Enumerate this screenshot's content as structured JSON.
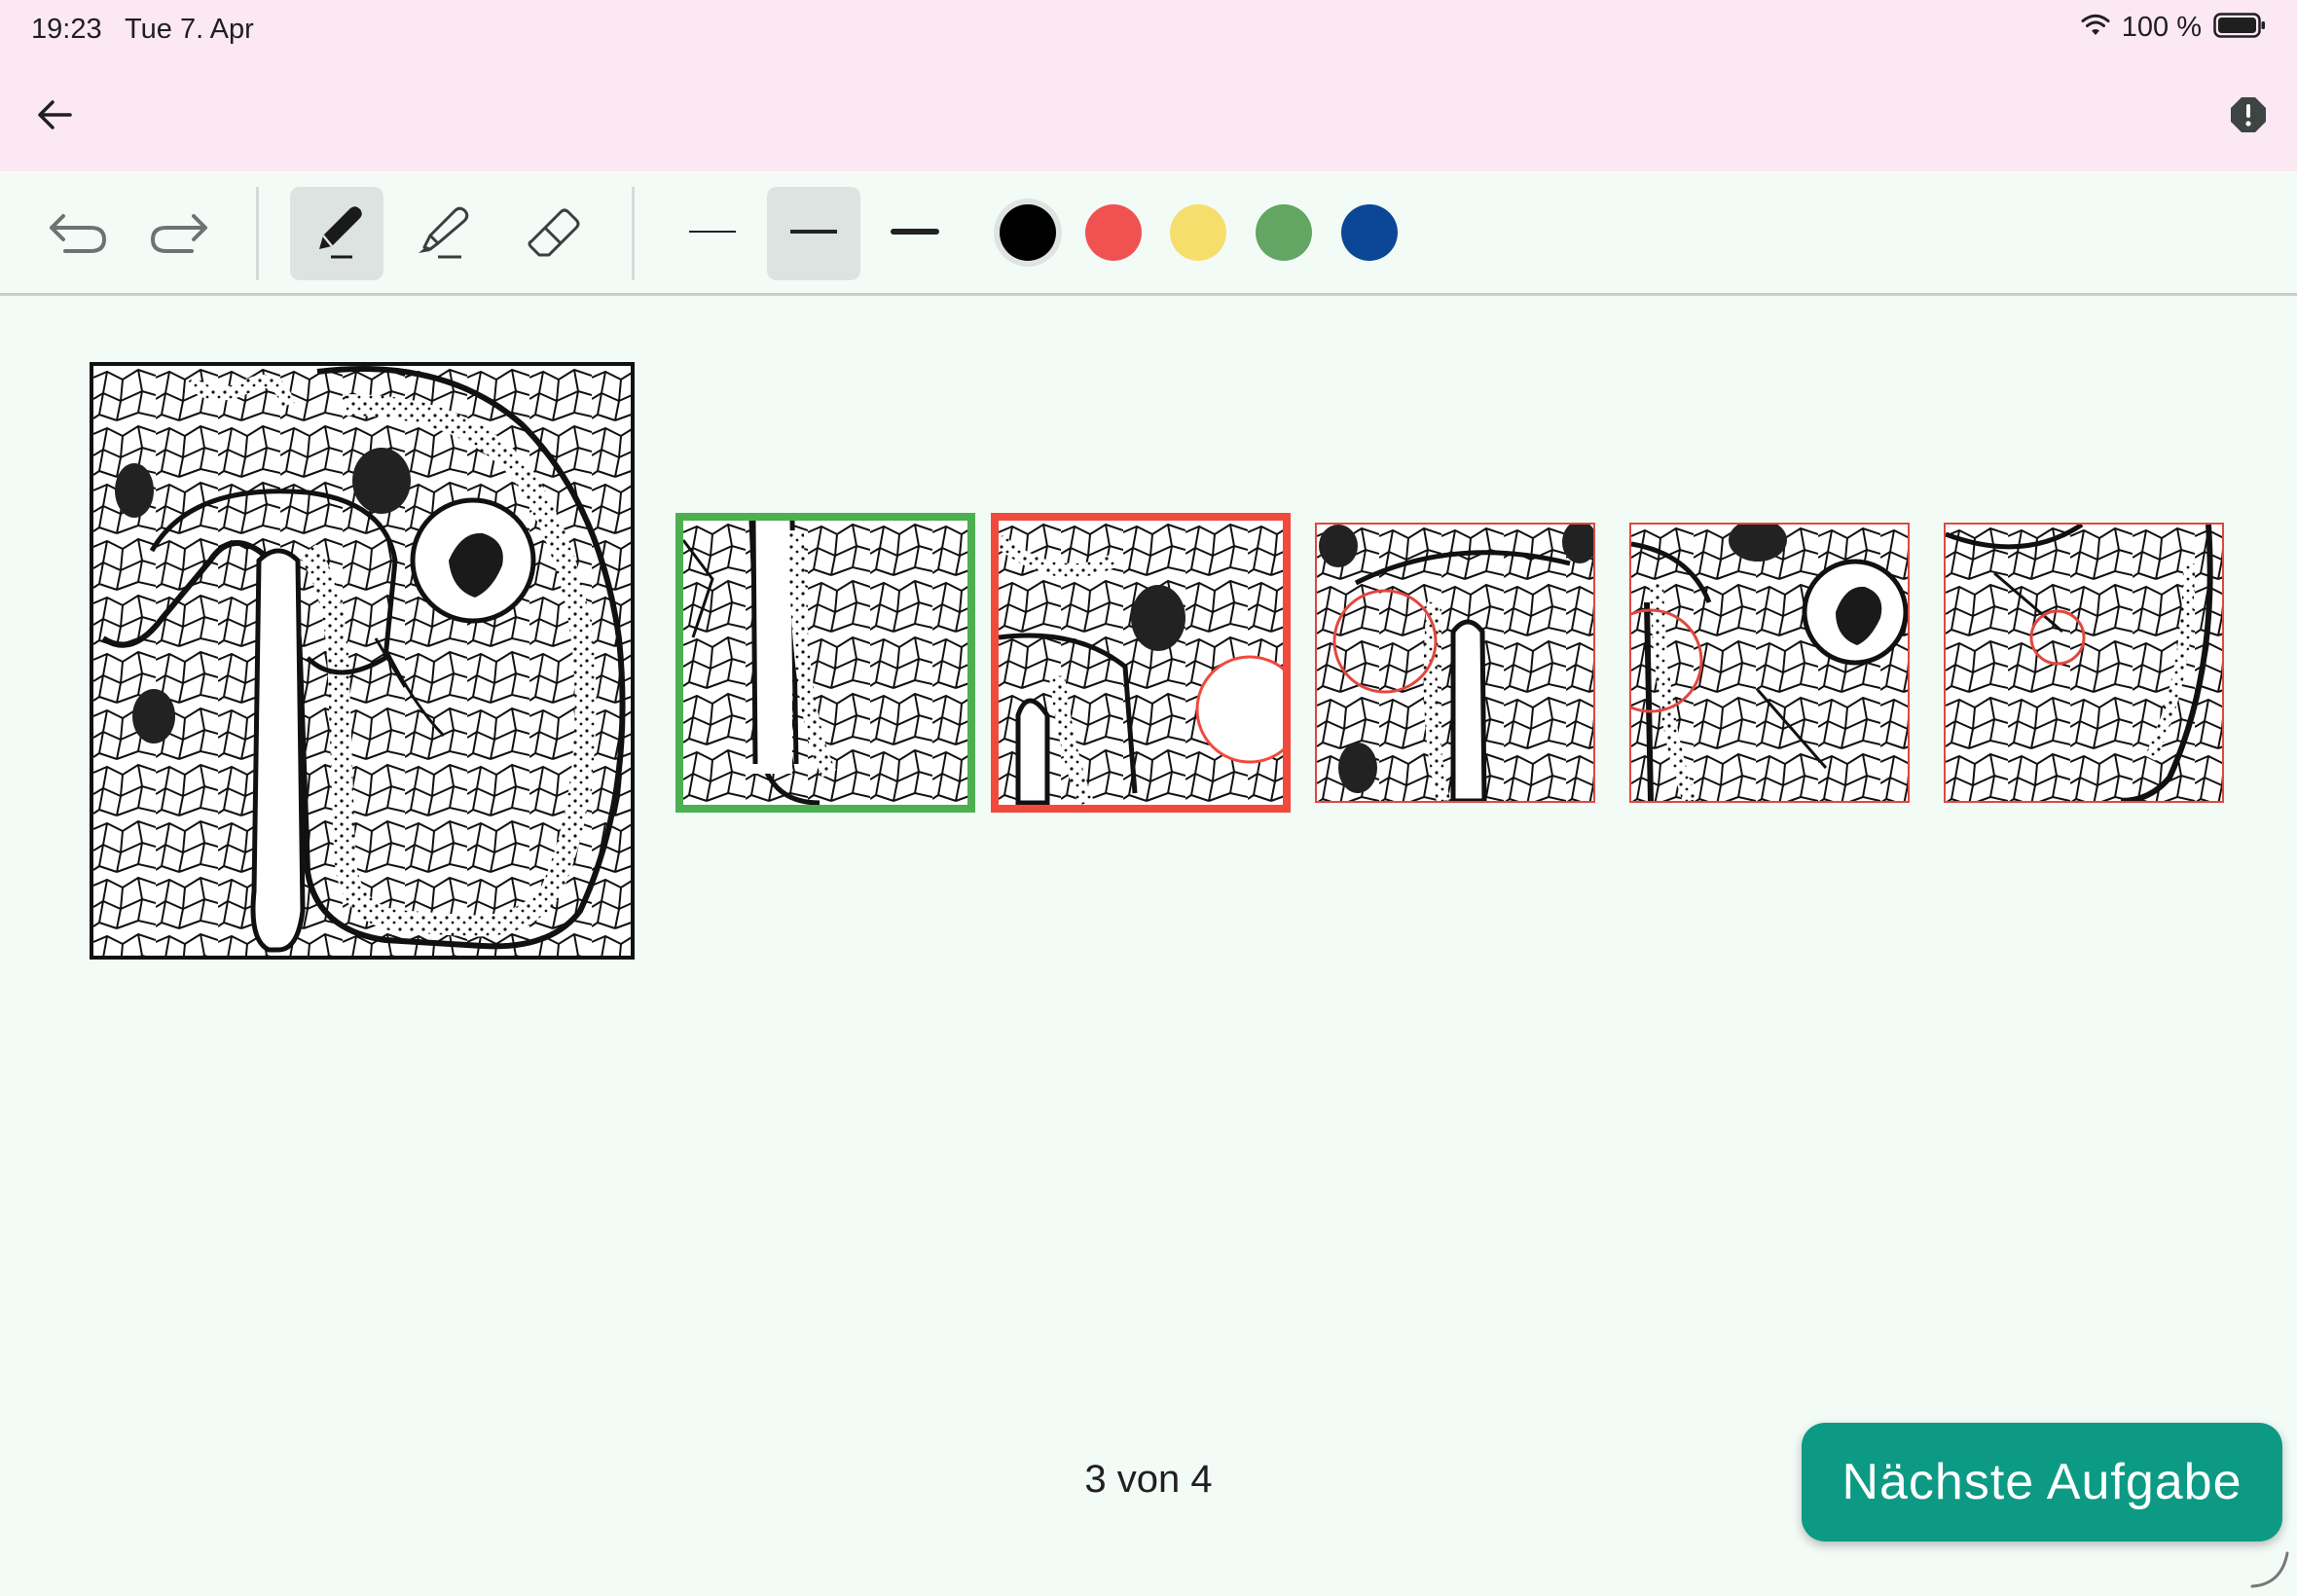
{
  "status_bar": {
    "time": "19:23",
    "date": "Tue 7. Apr",
    "battery_text": "100 %",
    "icons": [
      "wifi-icon",
      "battery-icon"
    ]
  },
  "app_bar": {
    "back_icon": "arrow-left-icon",
    "report_icon": "alert-octagon-icon"
  },
  "toolbar": {
    "history": [
      "undo-icon",
      "redo-icon"
    ],
    "tools": [
      {
        "name": "pen",
        "icon": "pen-icon",
        "active": true
      },
      {
        "name": "highlighter",
        "icon": "highlighter-icon",
        "active": false
      },
      {
        "name": "eraser",
        "icon": "eraser-icon",
        "active": false
      }
    ],
    "stroke_widths": [
      {
        "name": "thin",
        "active": false
      },
      {
        "name": "medium",
        "active": true
      },
      {
        "name": "thick",
        "active": false
      }
    ],
    "colors": [
      {
        "name": "black",
        "hex": "#000000",
        "selected": true
      },
      {
        "name": "red",
        "hex": "#f05252",
        "selected": false
      },
      {
        "name": "yellow",
        "hex": "#f6de6c",
        "selected": false
      },
      {
        "name": "green",
        "hex": "#63a563",
        "selected": false
      },
      {
        "name": "blue",
        "hex": "#0c4797",
        "selected": false
      }
    ]
  },
  "task": {
    "options": [
      {
        "state": "correct",
        "border_color": "#4caf50"
      },
      {
        "state": "wrong",
        "border_color": "#f14a3d"
      },
      {
        "state": "unselected",
        "border_color": "#e0483f"
      },
      {
        "state": "unselected",
        "border_color": "#e0483f"
      },
      {
        "state": "unselected",
        "border_color": "#e0483f"
      }
    ]
  },
  "footer": {
    "page_indicator": "3 von 4",
    "next_button_label": "Nächste Aufgabe"
  }
}
